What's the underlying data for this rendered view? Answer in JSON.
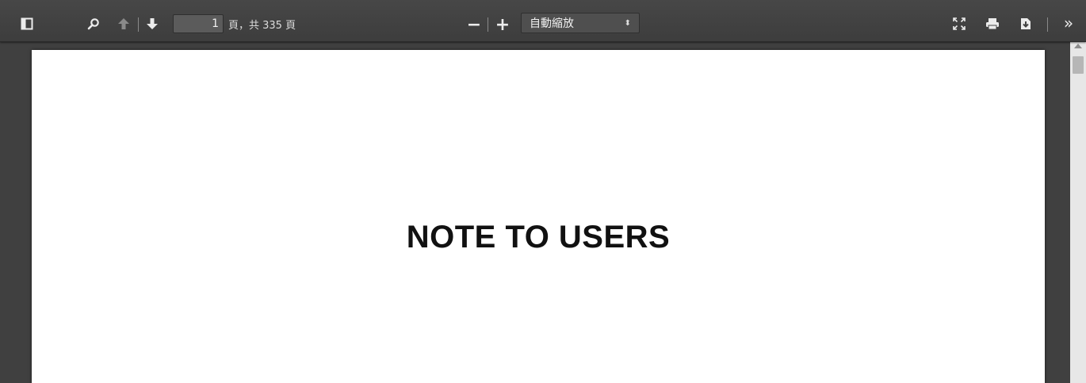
{
  "toolbar": {
    "page_number": "1",
    "page_count_label": "頁，共 335 頁",
    "zoom_value": "自動縮放",
    "zoom_arrow": "⬍",
    "more_glyph": "»",
    "zoom_out_glyph": "−",
    "zoom_in_glyph": "+",
    "icons": [
      "sidebar-toggle-icon",
      "search-icon",
      "previous-page-icon",
      "next-page-icon",
      "zoom-out-icon",
      "zoom-in-icon",
      "presentation-mode-icon",
      "print-icon",
      "download-icon",
      "tools-icon"
    ]
  },
  "document": {
    "heading": "NOTE TO USERS"
  },
  "colors": {
    "toolbar": "#444444",
    "background": "#404040",
    "page": "#ffffff",
    "icon": "#ececec"
  }
}
